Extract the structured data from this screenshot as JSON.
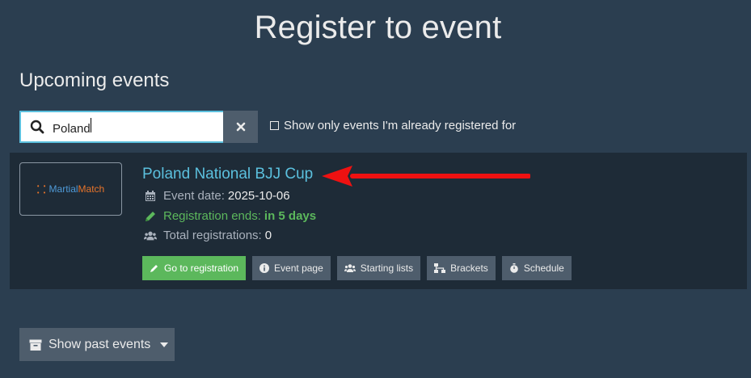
{
  "page": {
    "title": "Register to event",
    "section_title": "Upcoming events"
  },
  "search": {
    "value": "Poland",
    "clear_icon": "times-icon",
    "search_icon": "search-icon"
  },
  "filter": {
    "label": "Show only events I'm already registered for",
    "checked": false
  },
  "events": [
    {
      "logo": {
        "part1": "Martial",
        "part2": "Match"
      },
      "name": "Poland National BJJ Cup",
      "date_label": "Event date:",
      "date_value": "2025-10-06",
      "reg_label": "Registration ends:",
      "reg_value": "in 5 days",
      "total_label": "Total registrations:",
      "total_value": "0",
      "buttons": [
        {
          "label": "Go to registration",
          "icon": "pencil-icon"
        },
        {
          "label": "Event page",
          "icon": "info-circle-icon"
        },
        {
          "label": "Starting lists",
          "icon": "users-icon"
        },
        {
          "label": "Brackets",
          "icon": "sitemap-icon"
        },
        {
          "label": "Schedule",
          "icon": "stopwatch-icon"
        }
      ]
    }
  ],
  "past_events": {
    "label": "Show past events",
    "icon": "archive-icon"
  },
  "colors": {
    "background": "#2b3e50",
    "card": "#1e2b37",
    "accent_link": "#5bc0de",
    "success": "#5cb85c",
    "button": "#4e5d6c",
    "annotation_arrow": "#ee1111"
  }
}
